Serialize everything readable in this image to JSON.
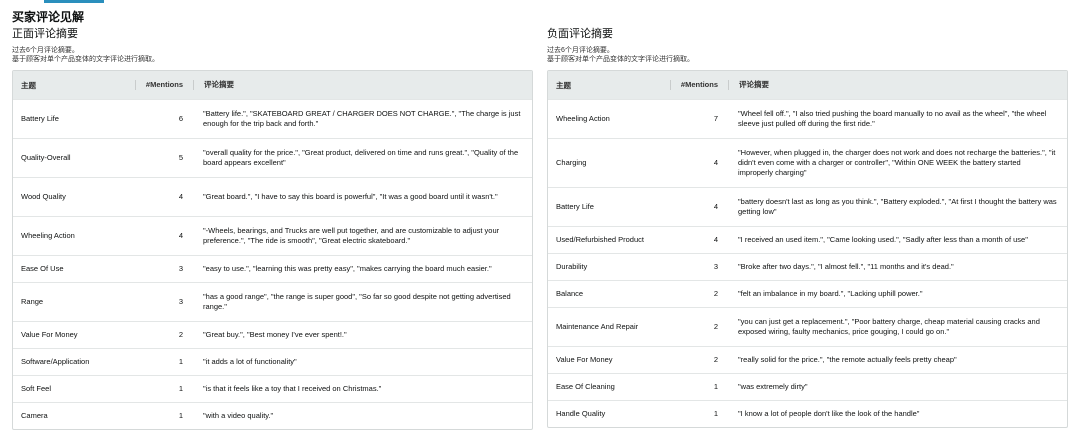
{
  "page_title": "买家评论见解",
  "positive": {
    "title": "正面评论摘要",
    "subtitle1": "过去6个月评论摘要。",
    "subtitle2": "基于顾客对单个产品变体的文字评论进行摘取。",
    "columns": [
      "主题",
      "#Mentions",
      "评论摘要"
    ],
    "rows": [
      {
        "topic": "Battery Life",
        "mentions": "6",
        "summary": "\"Battery life.\", \"SKATEBOARD GREAT / CHARGER DOES NOT CHARGE.\", \"The charge is just enough for the trip back and forth.\""
      },
      {
        "topic": "Quality-Overall",
        "mentions": "5",
        "summary": "\"overall quality for the price.\", \"Great product, delivered on time and runs great.\", \"Quality of the board appears excellent\""
      },
      {
        "topic": "Wood Quality",
        "mentions": "4",
        "summary": "\"Great board.\", \"I have to say this board is powerful\", \"It was a good board until it wasn't.\""
      },
      {
        "topic": "Wheeling Action",
        "mentions": "4",
        "summary": "\"-Wheels, bearings, and Trucks are well put together, and are customizable to adjust your preference.\", \"The ride is smooth\", \"Great electric skateboard.\""
      },
      {
        "topic": "Ease Of Use",
        "mentions": "3",
        "summary": "\"easy to use.\", \"learning this was pretty easy\", \"makes carrying the board much easier.\""
      },
      {
        "topic": "Range",
        "mentions": "3",
        "summary": "\"has a good range\", \"the range is super good\", \"So far so good despite not getting advertised range.\""
      },
      {
        "topic": "Value For Money",
        "mentions": "2",
        "summary": "\"Great buy.\", \"Best money I've ever spent!.\""
      },
      {
        "topic": "Software/Application",
        "mentions": "1",
        "summary": "\"it adds a lot of functionality\""
      },
      {
        "topic": "Soft Feel",
        "mentions": "1",
        "summary": "\"is that it feels like a toy that I received on Christmas.\""
      },
      {
        "topic": "Camera",
        "mentions": "1",
        "summary": "\"with a video quality.\""
      }
    ]
  },
  "negative": {
    "title": "负面评论摘要",
    "subtitle1": "过去6个月评论摘要。",
    "subtitle2": "基于顾客对单个产品变体的文字评论进行摘取。",
    "columns": [
      "主题",
      "#Mentions",
      "评论摘要"
    ],
    "rows": [
      {
        "topic": "Wheeling Action",
        "mentions": "7",
        "summary": "\"Wheel fell off.\", \"I also tried pushing the board manually to no avail as the wheel\", \"the wheel sleeve just pulled off during the first ride.\""
      },
      {
        "topic": "Charging",
        "mentions": "4",
        "summary": "\"However, when plugged in, the charger does not work and does not recharge the batteries.\", \"it didn't even come with a charger or controller\", \"Within ONE WEEK the battery started improperly charging\""
      },
      {
        "topic": "Battery Life",
        "mentions": "4",
        "summary": "\"battery doesn't last as long as you think.\", \"Battery exploded.\", \"At first I thought the battery was getting low\""
      },
      {
        "topic": "Used/Refurbished Product",
        "mentions": "4",
        "summary": "\"I received an used item.\", \"Came looking used.\", \"Sadly after less than a month of use\""
      },
      {
        "topic": "Durability",
        "mentions": "3",
        "summary": "\"Broke after two days.\", \"I almost fell.\", \"11 months and it's dead.\""
      },
      {
        "topic": "Balance",
        "mentions": "2",
        "summary": "\"felt an imbalance in my board.\", \"Lacking uphill power.\""
      },
      {
        "topic": "Maintenance And Repair",
        "mentions": "2",
        "summary": "\"you can just get a replacement.\", \"Poor battery charge, cheap material causing cracks and exposed wiring, faulty mechanics, price gouging, I could go on.\""
      },
      {
        "topic": "Value For Money",
        "mentions": "2",
        "summary": "\"really solid for the price.\", \"the remote actually feels pretty cheap\""
      },
      {
        "topic": "Ease Of Cleaning",
        "mentions": "1",
        "summary": "\"was extremely dirty\""
      },
      {
        "topic": "Handle Quality",
        "mentions": "1",
        "summary": "\"I know a lot of people don't like the look of the handle\""
      }
    ]
  }
}
